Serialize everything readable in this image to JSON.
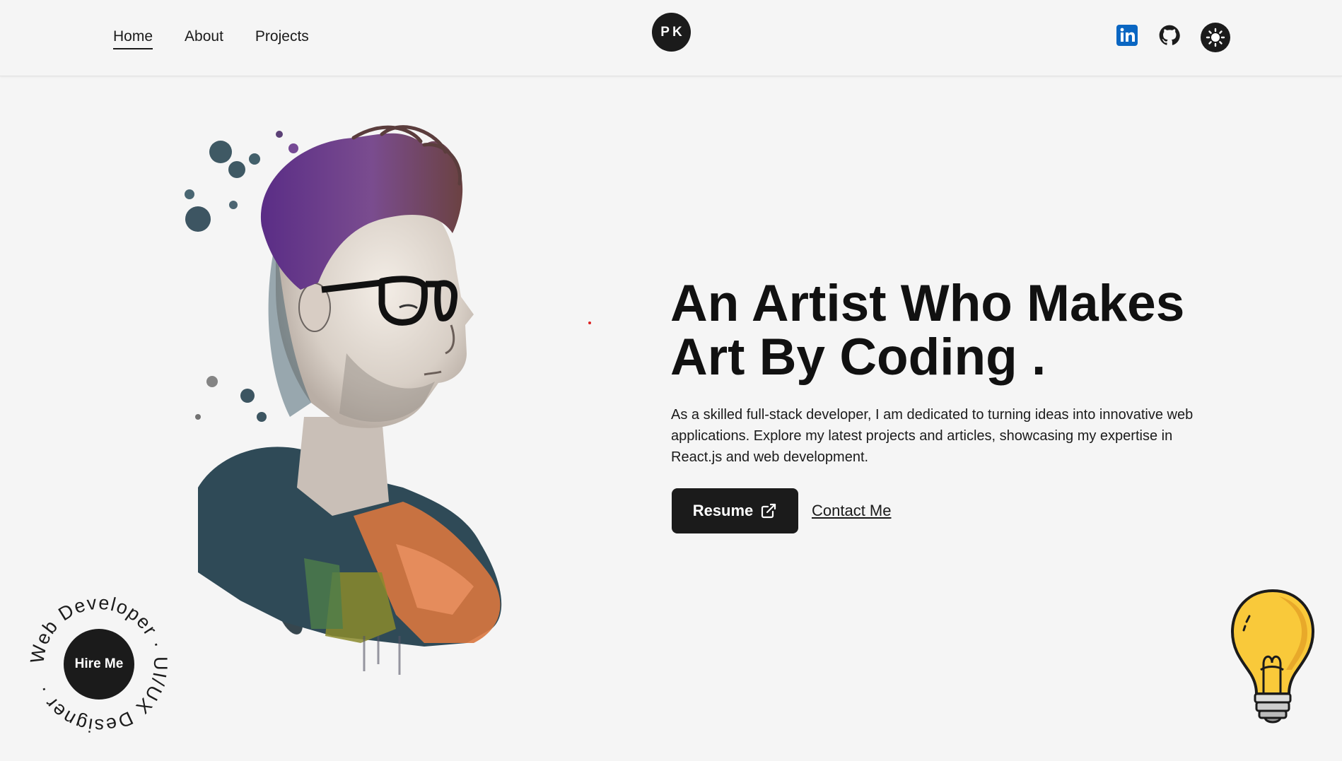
{
  "header": {
    "nav": [
      {
        "label": "Home",
        "active": true
      },
      {
        "label": "About",
        "active": false
      },
      {
        "label": "Projects",
        "active": false
      }
    ],
    "logo_text": "PK",
    "social_icons": [
      "linkedin-icon",
      "github-icon"
    ],
    "theme_icon": "sun-icon"
  },
  "hero": {
    "title_line1": "An Artist Who Makes",
    "title_line2": "Art By Coding .",
    "description": "As a skilled full-stack developer, I am dedicated to turning ideas into innovative web applications. Explore my latest projects and articles, showcasing my expertise in React.js and web development.",
    "resume_label": "Resume",
    "contact_label": "Contact Me"
  },
  "badge": {
    "button_label": "Hire Me",
    "ring_text": "Web Developer · UI/UX Designer ·"
  },
  "colors": {
    "background": "#f5f5f5",
    "dark": "#1b1b1b",
    "linkedin": "#0a66c2",
    "bulb": "#f9c93a"
  }
}
